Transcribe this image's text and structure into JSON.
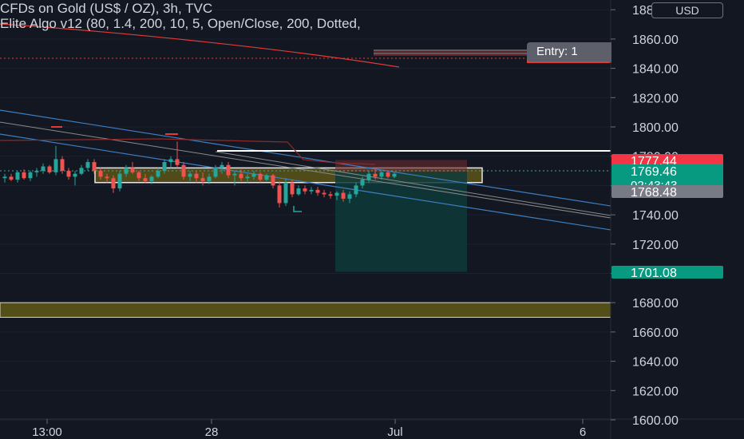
{
  "header": {
    "title": "CFDs on Gold (US$ / OZ), 3h, TVC",
    "indicator": "Elite Algo v12 (80, 1.4, 200, 10, 5, Open/Close, 200, Dotted,"
  },
  "currency_button": "USD",
  "entry_label": "Entry: 1",
  "colors": {
    "background": "#131722",
    "up": "#26a69a",
    "down": "#ef5350",
    "zone": "#6b6216"
  },
  "chart_data": {
    "type": "candlestick",
    "ylim": [
      1600,
      1880
    ],
    "y_ticks": [
      "1600.00",
      "1620.00",
      "1640.00",
      "1660.00",
      "1680.00",
      "1700.00",
      "1720.00",
      "1740.00",
      "1760.00",
      "1780.00",
      "1800.00",
      "1820.00",
      "1840.00",
      "1860.00",
      "1880.00"
    ],
    "x_ticks": [
      "13:00",
      "28",
      "Jul",
      "6"
    ],
    "price_labels": [
      {
        "text": "1777.44",
        "value": 1777.44,
        "color": "#f23645"
      },
      {
        "text": "1769.46",
        "value": 1769.46,
        "color": "#089981",
        "sub": "02:43:43"
      },
      {
        "text": "1768.48",
        "value": 1768.48,
        "color": "#787b86"
      },
      {
        "text": "1701.08",
        "value": 1701.08,
        "color": "#089981"
      }
    ],
    "candles": [
      [
        1765,
        1768,
        1762,
        1766
      ],
      [
        1766,
        1768,
        1763,
        1764
      ],
      [
        1764,
        1770,
        1762,
        1769
      ],
      [
        1769,
        1771,
        1764,
        1765
      ],
      [
        1765,
        1770,
        1763,
        1769
      ],
      [
        1769,
        1772,
        1766,
        1770
      ],
      [
        1770,
        1775,
        1768,
        1773
      ],
      [
        1773,
        1774,
        1768,
        1769
      ],
      [
        1769,
        1787,
        1767,
        1778
      ],
      [
        1778,
        1780,
        1768,
        1770
      ],
      [
        1770,
        1772,
        1764,
        1766
      ],
      [
        1766,
        1770,
        1760,
        1768
      ],
      [
        1768,
        1774,
        1767,
        1772
      ],
      [
        1772,
        1778,
        1770,
        1776
      ],
      [
        1776,
        1778,
        1768,
        1770
      ],
      [
        1770,
        1772,
        1764,
        1766
      ],
      [
        1766,
        1768,
        1762,
        1765
      ],
      [
        1765,
        1767,
        1755,
        1758
      ],
      [
        1758,
        1770,
        1756,
        1768
      ],
      [
        1768,
        1774,
        1766,
        1772
      ],
      [
        1772,
        1776,
        1768,
        1769
      ],
      [
        1769,
        1770,
        1763,
        1765
      ],
      [
        1765,
        1768,
        1762,
        1763
      ],
      [
        1763,
        1767,
        1761,
        1766
      ],
      [
        1766,
        1772,
        1765,
        1770
      ],
      [
        1770,
        1778,
        1768,
        1776
      ],
      [
        1776,
        1780,
        1772,
        1778
      ],
      [
        1778,
        1790,
        1772,
        1774
      ],
      [
        1774,
        1776,
        1764,
        1766
      ],
      [
        1766,
        1770,
        1763,
        1768
      ],
      [
        1768,
        1770,
        1762,
        1765
      ],
      [
        1765,
        1769,
        1760,
        1763
      ],
      [
        1763,
        1768,
        1761,
        1766
      ],
      [
        1766,
        1774,
        1765,
        1772
      ],
      [
        1772,
        1776,
        1768,
        1774
      ],
      [
        1774,
        1776,
        1765,
        1767
      ],
      [
        1767,
        1770,
        1760,
        1768
      ],
      [
        1768,
        1771,
        1763,
        1765
      ],
      [
        1765,
        1768,
        1762,
        1766
      ],
      [
        1766,
        1770,
        1764,
        1768
      ],
      [
        1768,
        1769,
        1762,
        1764
      ],
      [
        1764,
        1768,
        1763,
        1767
      ],
      [
        1767,
        1768,
        1758,
        1760
      ],
      [
        1760,
        1763,
        1745,
        1748
      ],
      [
        1748,
        1765,
        1746,
        1762
      ],
      [
        1762,
        1764,
        1752,
        1754
      ],
      [
        1754,
        1760,
        1753,
        1758
      ],
      [
        1758,
        1760,
        1754,
        1756
      ],
      [
        1756,
        1759,
        1754,
        1757
      ],
      [
        1757,
        1759,
        1753,
        1755
      ],
      [
        1755,
        1757,
        1752,
        1754
      ],
      [
        1754,
        1756,
        1751,
        1753
      ],
      [
        1753,
        1756,
        1750,
        1755
      ],
      [
        1755,
        1757,
        1749,
        1751
      ],
      [
        1751,
        1756,
        1748,
        1754
      ],
      [
        1754,
        1762,
        1752,
        1760
      ],
      [
        1760,
        1766,
        1758,
        1764
      ],
      [
        1764,
        1770,
        1762,
        1768
      ],
      [
        1768,
        1771,
        1764,
        1766
      ],
      [
        1766,
        1770,
        1764,
        1769
      ],
      [
        1769,
        1770,
        1765,
        1766
      ],
      [
        1766,
        1769,
        1765,
        1768
      ]
    ]
  }
}
